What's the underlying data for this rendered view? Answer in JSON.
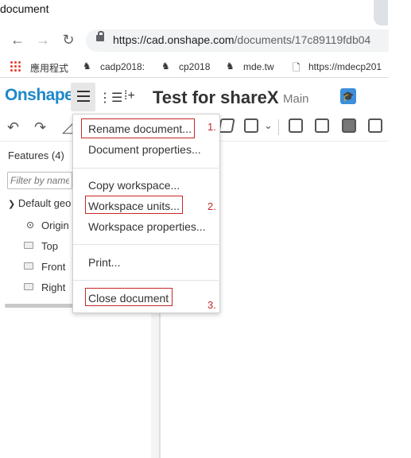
{
  "browser": {
    "tab_title": "document",
    "address": {
      "url_host": "https://cad.onshape.com",
      "url_path": "/documents/17c89119fdb04"
    },
    "bookmarks": [
      {
        "label": "應用程式"
      },
      {
        "label": "cadp2018:"
      },
      {
        "label": "cp2018"
      },
      {
        "label": "mde.tw"
      },
      {
        "label": "https://mdecp201"
      }
    ]
  },
  "onshape": {
    "logo": "Onshape",
    "document_title": "Test for shareX",
    "workspace": "Main"
  },
  "features_panel": {
    "heading": "Features (4)",
    "filter_placeholder": "Filter by name",
    "default_group": "Default geo",
    "items": [
      {
        "label": "Origin"
      },
      {
        "label": "Top"
      },
      {
        "label": "Front"
      },
      {
        "label": "Right"
      }
    ]
  },
  "document_menu": {
    "items": [
      {
        "label": "Rename document..."
      },
      {
        "label": "Document properties..."
      },
      {
        "label": "Copy workspace..."
      },
      {
        "label": "Workspace units..."
      },
      {
        "label": "Workspace properties..."
      },
      {
        "label": "Print..."
      },
      {
        "label": "Close document"
      }
    ],
    "annotations": [
      "1.",
      "2.",
      "3."
    ],
    "highlight_color": "#c62828"
  }
}
